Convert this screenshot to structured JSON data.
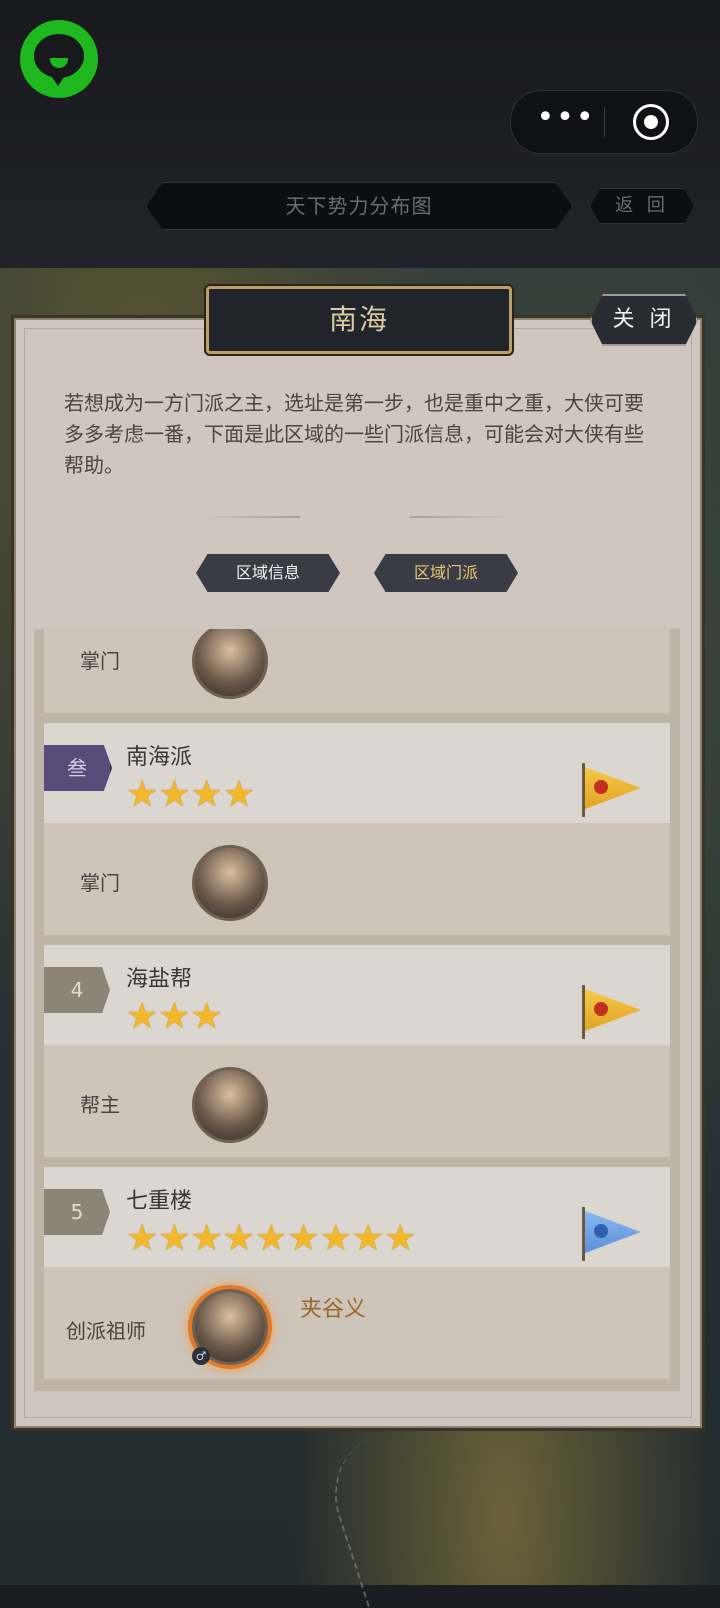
{
  "header": {
    "title": "天下势力分布图",
    "back_label": "返 回",
    "menu_dots": "•••"
  },
  "dialog": {
    "title": "南海",
    "close_label": "关 闭",
    "description": "若想成为一方门派之主，选址是第一步，也是重中之重，大侠可要多多考虑一番，下面是此区域的一些门派信息，可能会对大侠有些帮助。",
    "tabs": [
      {
        "label": "区域信息",
        "active": false
      },
      {
        "label": "区域门派",
        "active": true
      }
    ]
  },
  "sects": {
    "first_role": "掌门",
    "items": [
      {
        "rank": "叁",
        "name": "南海派",
        "stars": "★★★★",
        "star_count": 4,
        "flag": "red",
        "role": "掌门"
      },
      {
        "rank": "4",
        "name": "海盐帮",
        "stars": "★★★",
        "star_count": 3,
        "flag": "red",
        "role": "帮主"
      },
      {
        "rank": "5",
        "name": "七重楼",
        "stars": "★★★★★★★★★",
        "star_count": 9,
        "flag": "blue",
        "role": "创派祖师",
        "leader_name": "夹谷义"
      }
    ]
  },
  "colors": {
    "star": "#f2b82a",
    "rank_purple": "#5a4a7a",
    "active_tab_text": "#e6c770",
    "logo_green": "#1fb81f"
  }
}
